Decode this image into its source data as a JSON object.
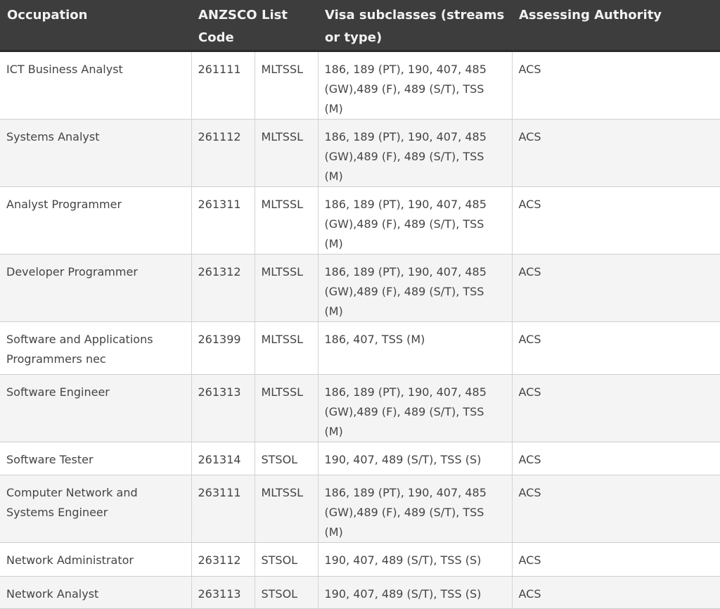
{
  "headers": [
    "Occupation",
    "ANZSCO Code",
    "List",
    "Visa subclasses (streams or type)",
    "Assessing Authority"
  ],
  "rows": [
    [
      "ICT Business Analyst",
      "261111",
      "MLTSSL",
      "186, 189 (PT), 190, 407, 485 (GW),489 (F), 489 (S/T), TSS (M)",
      "ACS"
    ],
    [
      "Systems Analyst",
      "261112",
      "MLTSSL",
      "186, 189 (PT), 190, 407, 485 (GW),489 (F), 489 (S/T), TSS (M)",
      "ACS"
    ],
    [
      "Analyst Programmer",
      "261311",
      "MLTSSL",
      "186, 189 (PT), 190, 407, 485 (GW),489 (F), 489 (S/T), TSS (M)",
      "ACS"
    ],
    [
      "Developer Programmer",
      "261312",
      "MLTSSL",
      "186, 189 (PT), 190, 407, 485 (GW),489 (F), 489 (S/T), TSS (M)",
      "ACS"
    ],
    [
      "Software and Applications Programmers nec",
      "261399",
      "MLTSSL",
      "186, 407, TSS (M)",
      "ACS"
    ],
    [
      "Software Engineer",
      "261313",
      "MLTSSL",
      "186, 189 (PT), 190, 407, 485 (GW),489 (F), 489 (S/T), TSS (M)",
      "ACS"
    ],
    [
      "Software Tester",
      "261314",
      "STSOL",
      "190, 407, 489 (S/T), TSS (S)",
      "ACS"
    ],
    [
      "Computer Network and Systems Engineer",
      "263111",
      "MLTSSL",
      "186, 189 (PT), 190, 407, 485 (GW),489 (F), 489 (S/T), TSS (M)",
      "ACS"
    ],
    [
      "Network Administrator",
      "263112",
      "STSOL",
      "190, 407, 489 (S/T), TSS (S)",
      "ACS"
    ],
    [
      "Network Analyst",
      "263113",
      "STSOL",
      "190, 407, 489 (S/T), TSS (S)",
      "ACS"
    ]
  ]
}
